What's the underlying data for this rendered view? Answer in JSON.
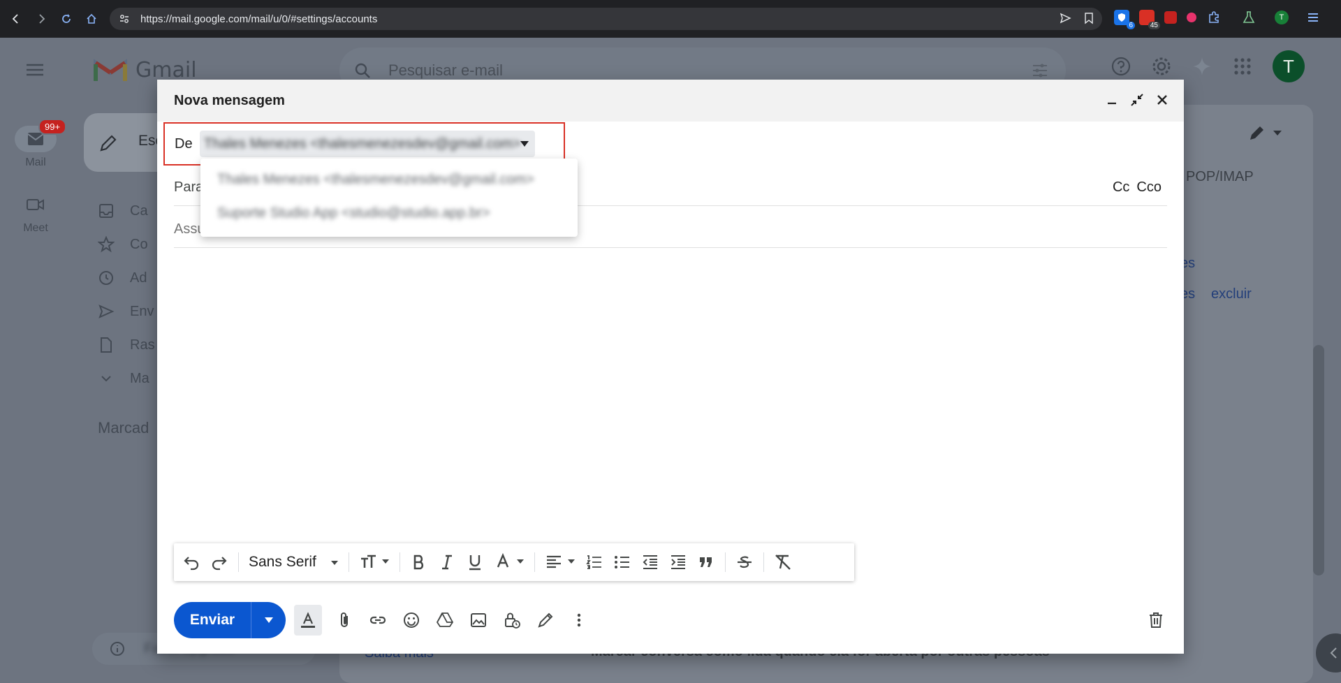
{
  "browser": {
    "url": "https://mail.google.com/mail/u/0/#settings/accounts",
    "extensions": [
      {
        "name": "shield-extension",
        "badge": "6",
        "color": "#1a73e8"
      },
      {
        "name": "calendar-extension",
        "badge": "45",
        "color": "#d93025"
      },
      {
        "name": "red-extension",
        "badge": "",
        "color": "#c5221f"
      },
      {
        "name": "pink-extension",
        "badge": "",
        "color": "#e8336c"
      },
      {
        "name": "puzzle-extension",
        "badge": "",
        "color": "#1a73e8"
      },
      {
        "name": "flask-extension",
        "badge": "",
        "color": "#34a853"
      }
    ],
    "profile_letter": "T"
  },
  "gmail": {
    "logo_text": "Gmail",
    "search_placeholder": "Pesquisar e-mail",
    "avatar_letter": "T",
    "rail": {
      "mail_label": "Mail",
      "mail_badge": "99+",
      "meet_label": "Meet"
    },
    "compose_label": "Esc",
    "nav_items": [
      "Ca",
      "Co",
      "Ad",
      "Env",
      "Ras",
      "Ma"
    ],
    "labels_title": "Marcad",
    "bottom_pill_text": "Fazer upgrade",
    "bg_texts": {
      "pop_imap": "POP/IMAP",
      "link_1": "es",
      "link_2": "es",
      "link_3": "excluir",
      "saiba_mais": "Saiba mais",
      "marcar": "Marcar conversa como lida quando ela for aberta por outras pessoas"
    }
  },
  "compose": {
    "title": "Nova mensagem",
    "from_label": "De",
    "from_value": "Thales Menezes <thalesmenezesdev@gmail.com>",
    "to_label": "Para",
    "cc_label": "Cc",
    "bcc_label": "Cco",
    "subject_label": "Assunto",
    "from_options": [
      "Thales Menezes <thalesmenezesdev@gmail.com>",
      "Suporte Studio App <studio@studio.app.br>"
    ],
    "font_name": "Sans Serif",
    "send_label": "Enviar"
  }
}
